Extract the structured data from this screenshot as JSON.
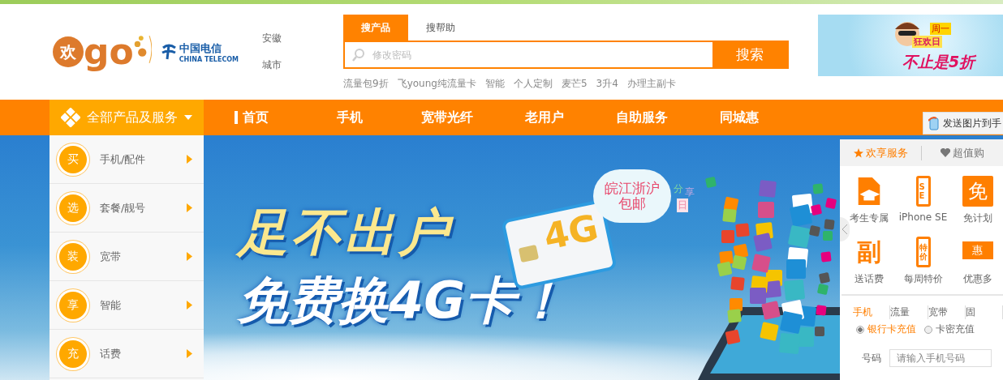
{
  "logo": {
    "mark": "欢",
    "brand": "go",
    "partner_cn": "中国电信",
    "partner_en": "CHINA TELECOM"
  },
  "location": [
    "安徽",
    "城市"
  ],
  "search": {
    "tabs": [
      {
        "label": "搜产品",
        "selected": true
      },
      {
        "label": "搜帮助",
        "selected": false
      }
    ],
    "placeholder": "修改密码",
    "button": "搜索",
    "hot_words": [
      "流量包9折",
      "飞young纯流量卡",
      "智能",
      "个人定制",
      "麦芒5",
      "3升4",
      "办理主副卡"
    ]
  },
  "top_ad": {
    "tag": "周一",
    "lines": [
      "狂欢日",
      "不止是5折"
    ]
  },
  "nav": {
    "all_products": "全部产品及服务",
    "items": [
      {
        "label": "首页",
        "selected": true
      },
      {
        "label": "手机",
        "selected": false
      },
      {
        "label": "宽带光纤",
        "selected": false
      },
      {
        "label": "老用户",
        "selected": false
      },
      {
        "label": "自助服务",
        "selected": false
      },
      {
        "label": "同城惠",
        "selected": false
      }
    ]
  },
  "send_button": "发送图片到手",
  "categories": [
    {
      "badge": "买",
      "label": "手机/配件"
    },
    {
      "badge": "选",
      "label": "套餐/靓号"
    },
    {
      "badge": "装",
      "label": "宽带"
    },
    {
      "badge": "享",
      "label": "智能"
    },
    {
      "badge": "充",
      "label": "话费"
    }
  ],
  "banner": {
    "headline": [
      "足不出户",
      "免费换4G卡！"
    ],
    "cloud": [
      "皖江浙沪",
      "包邮"
    ],
    "tag": [
      "分",
      "享",
      "日"
    ],
    "card": "4G"
  },
  "service_panel": {
    "tabs": [
      {
        "label": "欢享服务",
        "selected": true
      },
      {
        "label": "超值购",
        "selected": false
      }
    ],
    "items": [
      {
        "kind": "graduate",
        "label": "考生专属"
      },
      {
        "kind": "phone",
        "icon_text": "SE",
        "label": "iPhone SE"
      },
      {
        "kind": "glyph",
        "icon_text": "免",
        "label": "免计划"
      },
      {
        "kind": "plain-glyph",
        "icon_text": "副",
        "label": "送话费"
      },
      {
        "kind": "phone",
        "icon_text": "特价",
        "label": "每周特价"
      },
      {
        "kind": "ticket",
        "icon_text": "惠",
        "label": "优惠多"
      }
    ],
    "recharge": {
      "tabs": [
        {
          "label": "手机",
          "selected": true
        },
        {
          "label": "流量",
          "selected": false
        },
        {
          "label": "宽带",
          "selected": false
        },
        {
          "label": "固",
          "selected": false
        }
      ],
      "options": [
        {
          "label": "银行卡充值",
          "selected": true
        },
        {
          "label": "卡密充值",
          "selected": false
        }
      ],
      "number_label": "号码",
      "placeholder": "请输入手机号码"
    }
  }
}
